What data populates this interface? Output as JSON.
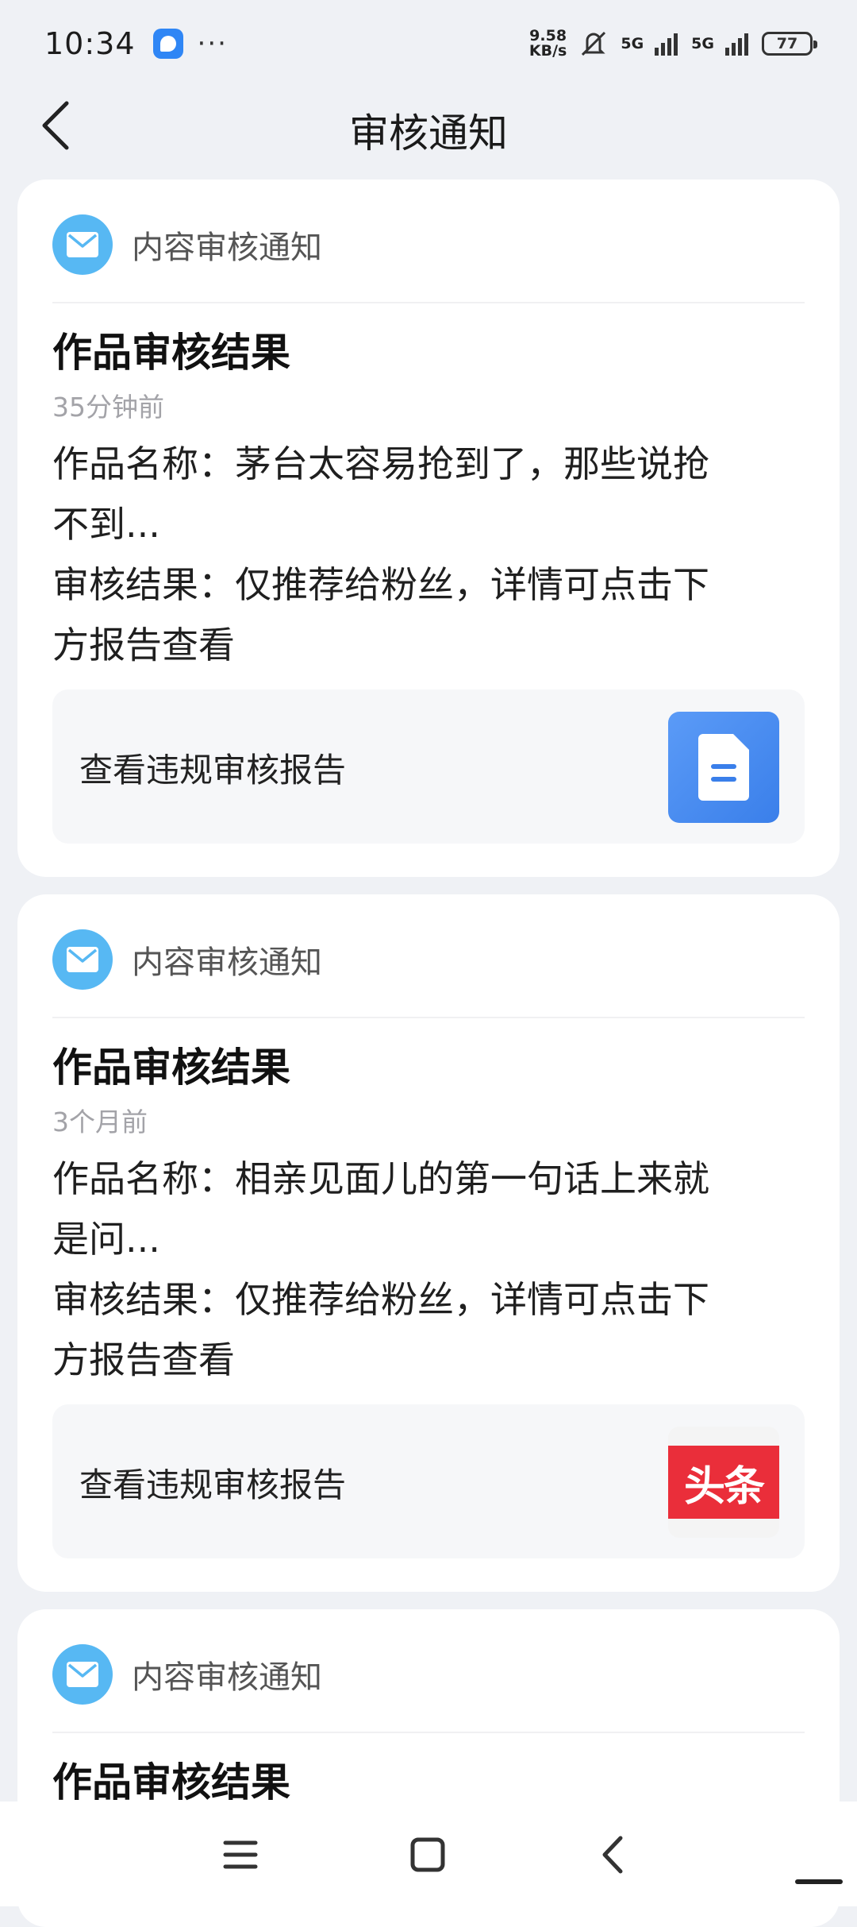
{
  "status_bar": {
    "time": "10:34",
    "dots": "···",
    "net_speed_value": "9.58",
    "net_speed_unit": "KB/s",
    "sim1": "5G",
    "sim2": "5G",
    "battery": "77",
    "icons": [
      "app-notification-icon",
      "mute-icon",
      "signal-icon",
      "signal-icon",
      "battery-icon"
    ]
  },
  "header": {
    "title": "审核通知",
    "back_icon": "chevron-left-icon"
  },
  "notifications": [
    {
      "category": "内容审核通知",
      "title": "作品审核结果",
      "time": "35分钟前",
      "work_line1": "作品名称：茅台太容易抢到了，那些说抢",
      "work_line2": "不到...",
      "result_line1": "审核结果：仅推荐给粉丝，详情可点击下",
      "result_line2": "方报告查看",
      "report_label": "查看违规审核报告",
      "thumb": "document-icon"
    },
    {
      "category": "内容审核通知",
      "title": "作品审核结果",
      "time": "3个月前",
      "work_line1": "作品名称：相亲见面儿的第一句话上来就",
      "work_line2": "是问...",
      "result_line1": "审核结果：仅推荐给粉丝，详情可点击下",
      "result_line2": "方报告查看",
      "report_label": "查看违规审核报告",
      "thumb_text": "头条"
    },
    {
      "category": "内容审核通知",
      "title": "作品审核结果"
    }
  ],
  "nav_buttons": [
    "menu-icon",
    "home-icon",
    "back-icon"
  ],
  "colors": {
    "background": "#eff1f5",
    "accent_blue": "#3a7fea",
    "mail_icon": "#57b8f3",
    "toutiao_red": "#ea2e3a"
  }
}
